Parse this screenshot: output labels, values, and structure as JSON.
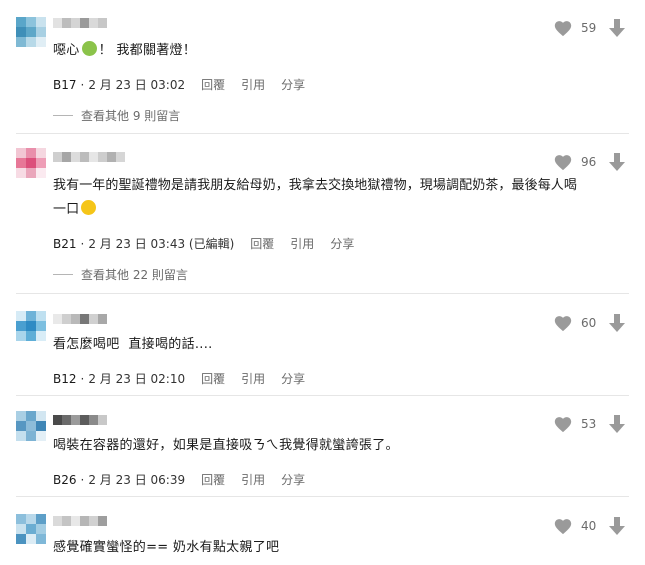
{
  "actions": {
    "reply": "回覆",
    "quote": "引用",
    "share": "分享"
  },
  "comments": [
    {
      "likes": "59",
      "text_parts": [
        "噁心",
        "！ 我都關著燈！"
      ],
      "emoji": "nauseated-face",
      "floor": "B17",
      "date": "2 月 23 日 03:02",
      "more": "查看其他 9 則留言"
    },
    {
      "likes": "96",
      "text_line1": "我有一年的聖誕禮物是請我朋友給母奶，我拿去交換地獄禮物，現場調配奶茶，最後每人喝",
      "text_line2": "一口",
      "emoji": "laughing-face",
      "floor": "B21",
      "date": "2 月 23 日 03:43 (已編輯)",
      "more": "查看其他 22 則留言"
    },
    {
      "likes": "60",
      "text": "看怎麼喝吧  直接喝的話....",
      "floor": "B12",
      "date": "2 月 23 日 02:10"
    },
    {
      "likes": "53",
      "text": "喝裝在容器的還好，如果是直接吸ㄋㄟ我覺得就蠻誇張了。",
      "floor": "B26",
      "date": "2 月 23 日 06:39"
    },
    {
      "likes": "40",
      "text": "感覺確實蠻怪的== 奶水有點太親了吧"
    }
  ],
  "colors": {
    "icon_gray": "#9a9a9a",
    "divider": "#e6e6e6"
  }
}
